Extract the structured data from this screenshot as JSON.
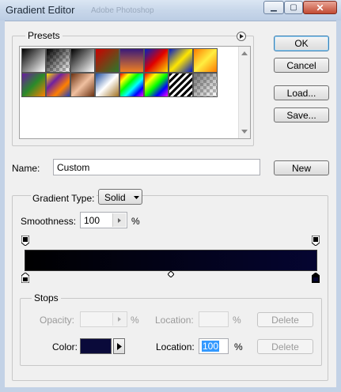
{
  "window": {
    "title": "Gradient Editor",
    "ghost_title": "Adobe Photoshop",
    "minimize": "▁",
    "maximize": "▢",
    "close": "✕"
  },
  "presets": {
    "label": "Presets",
    "menu_icon": "play-arrow-icon",
    "swatches": [
      {
        "name": "foreground-to-background",
        "style": "linear-gradient(135deg,#000 0%,#fff 100%)"
      },
      {
        "name": "foreground-to-transparent",
        "style": "checker-black"
      },
      {
        "name": "black-white",
        "style": "linear-gradient(135deg,#000 0%,#fff 100%)"
      },
      {
        "name": "red-green",
        "style": "linear-gradient(135deg,#c00 0%,#2a7a2a 100%)"
      },
      {
        "name": "violet-orange",
        "style": "linear-gradient(180deg,#3a1a7a 0%,#f08020 100%)"
      },
      {
        "name": "blue-red-yellow",
        "style": "linear-gradient(135deg,#0020c0 0%,#e00000 50%,#ffe000 100%)"
      },
      {
        "name": "blue-yellow-blue",
        "style": "linear-gradient(135deg,#0018c8 0%,#ffe600 50%,#0018c8 100%)"
      },
      {
        "name": "orange-yellow-orange",
        "style": "linear-gradient(135deg,#ff7a00 0%,#ffee40 50%,#ff7a00 100%)"
      },
      {
        "name": "violet-green-orange",
        "style": "linear-gradient(135deg,#6a1aa0 0%,#2a8a2a 50%,#ff8000 100%)"
      },
      {
        "name": "yellow-violet-orange-blue",
        "style": "linear-gradient(135deg,#ffe000 0%,#7020a0 33%,#ff8000 66%,#2040c0 100%)"
      },
      {
        "name": "copper",
        "style": "linear-gradient(135deg,#6a3010 0%,#f0c0a0 50%,#6a3010 100%)"
      },
      {
        "name": "chrome",
        "style": "linear-gradient(135deg,#2050a0 0%,#ffffff 50%,#a07020 100%)"
      },
      {
        "name": "spectrum",
        "style": "linear-gradient(135deg,#f00 0%,#ff0 20%,#0f0 40%,#0ff 60%,#00f 80%,#f0f 100%)"
      },
      {
        "name": "transparent-rainbow",
        "style": "linear-gradient(135deg,#f00 0%,#ff0 25%,#0f0 50%,#00f 75%,#f0f 100%)"
      },
      {
        "name": "transparent-stripes",
        "style": "stripes"
      },
      {
        "name": "neutral-density",
        "style": "checker-gray"
      }
    ]
  },
  "buttons": {
    "ok": "OK",
    "cancel": "Cancel",
    "load": "Load...",
    "save": "Save...",
    "new": "New"
  },
  "name_field": {
    "label": "Name:",
    "value": "Custom"
  },
  "gradient": {
    "type_label": "Gradient Type:",
    "type_value": "Solid",
    "smoothness_label": "Smoothness:",
    "smoothness_value": "100",
    "smoothness_unit": "%",
    "bar_colors": [
      "#000000",
      "#050531"
    ],
    "opacity_stop_icon": "opacity-stop-icon",
    "color_stop_icon": "color-stop-icon",
    "midpoint_icon": "midpoint-diamond-icon"
  },
  "stops": {
    "label": "Stops",
    "opacity_label": "Opacity:",
    "opacity_unit": "%",
    "opacity_location_label": "Location:",
    "opacity_location_unit": "%",
    "opacity_delete": "Delete",
    "color_label": "Color:",
    "color_value": "#0a0a3a",
    "color_location_label": "Location:",
    "color_location_value": "100",
    "color_location_unit": "%",
    "color_delete": "Delete"
  }
}
